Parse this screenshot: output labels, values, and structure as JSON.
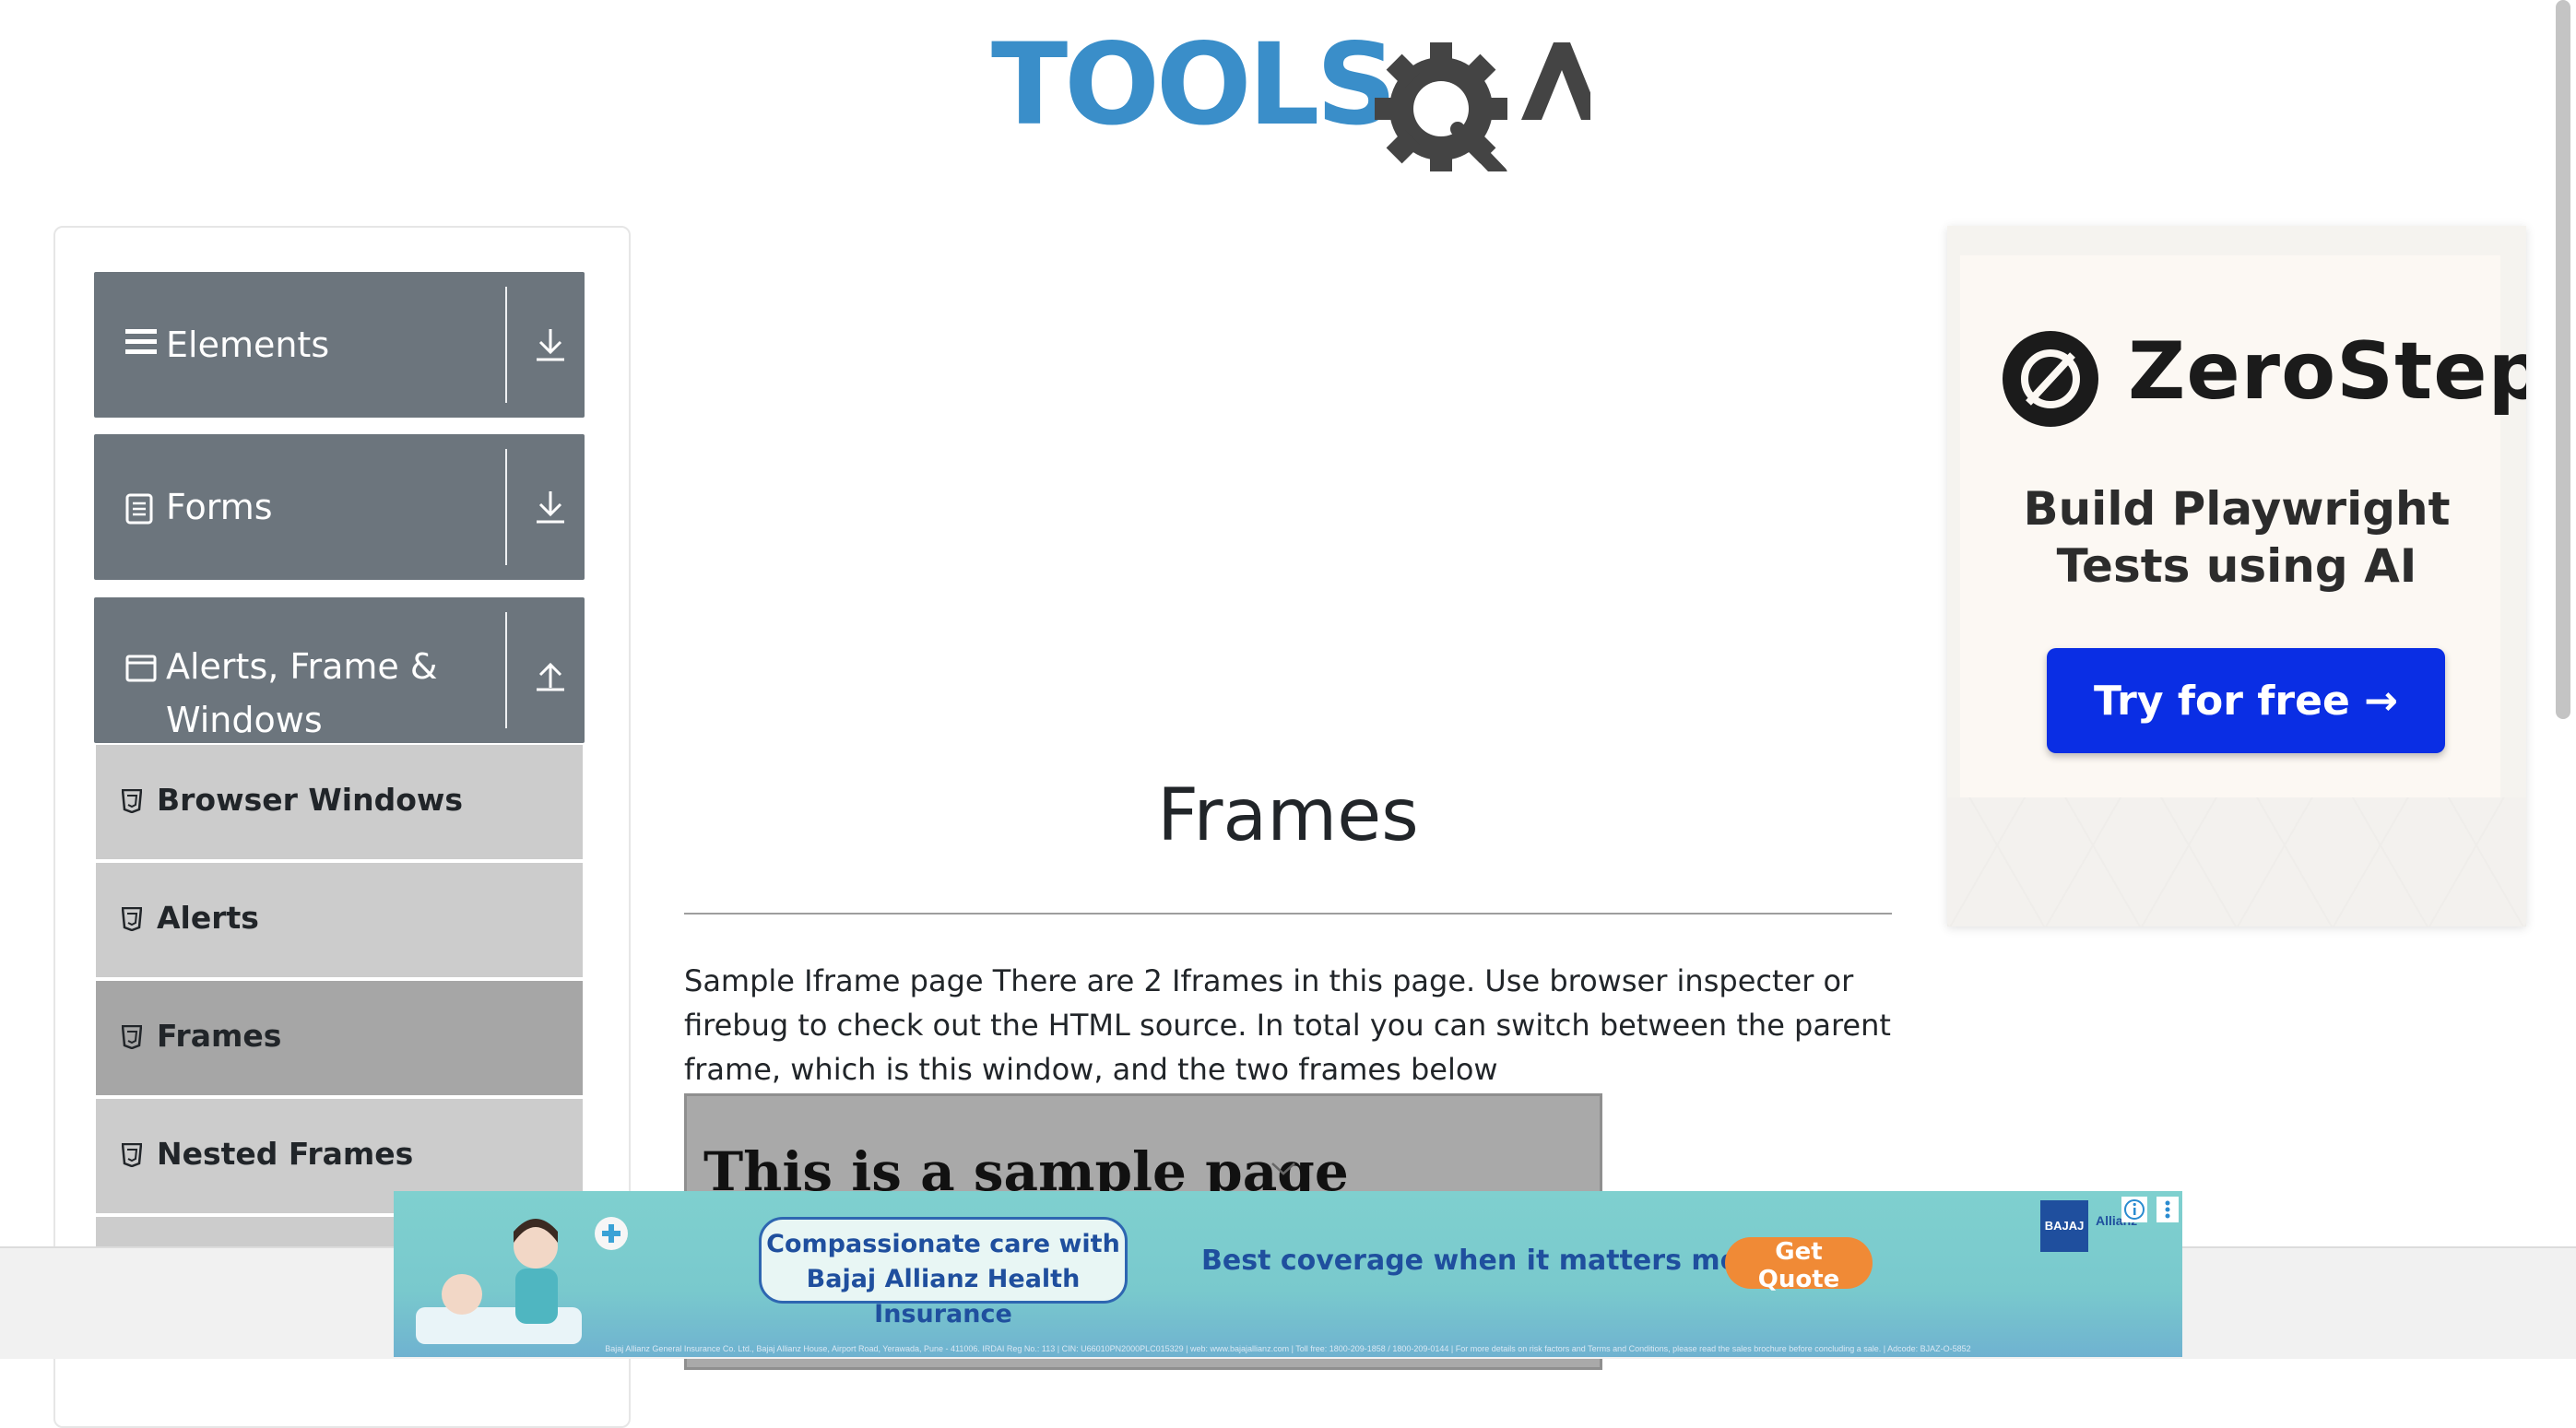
{
  "header": {
    "logo_text": "TOOLSQA"
  },
  "sidebar": {
    "groups": [
      {
        "label": "Elements",
        "icon": "hamburger-icon",
        "arrow": "download-arrow-icon"
      },
      {
        "label": "Forms",
        "icon": "document-icon",
        "arrow": "download-arrow-icon"
      },
      {
        "label_line1": "Alerts, Frame &",
        "label_line2": "Windows",
        "icon": "window-icon",
        "arrow": "upload-arrow-icon"
      }
    ],
    "items": [
      {
        "label": "Browser Windows",
        "icon": "html5-icon"
      },
      {
        "label": "Alerts",
        "icon": "html5-icon"
      },
      {
        "label": "Frames",
        "icon": "html5-icon",
        "active": true
      },
      {
        "label": "Nested Frames",
        "icon": "html5-icon"
      }
    ]
  },
  "main": {
    "title": "Frames",
    "intro": "Sample Iframe page There are 2 Iframes in this page. Use browser inspecter or firebug to check out the HTML source. In total you can switch between the parent frame, which is this window, and the two frames below",
    "iframe_heading": "This is a sample page"
  },
  "side_ad": {
    "brand": "ZeroStep",
    "tagline_line1": "Build Playwright",
    "tagline_line2": "Tests using AI",
    "cta": "Try for free →",
    "cta_color": "#0a2ee4"
  },
  "bottom_ad": {
    "bubble_line1": "Compassionate care with",
    "bubble_line2": "Bajaj Allianz Health Insurance",
    "headline": "Best coverage when it matters most",
    "button": "Get Quote",
    "brand": "BAJAJ",
    "brand_sub": "Allianz",
    "fineprint": "Bajaj Allianz General Insurance Co. Ltd., Bajaj Allianz House, Airport Road, Yerawada, Pune - 411006. IRDAI Reg No.: 113 | CIN: U66010PN2000PLC015329 | web: www.bajajallianz.com | Toll free: 1800-209-1858 / 1800-209-0144 | For more details on risk factors and Terms and Conditions, please read the sales brochure before concluding a sale. | Adcode: BJAZ-O-5852",
    "accent_color": "#f08a36"
  }
}
